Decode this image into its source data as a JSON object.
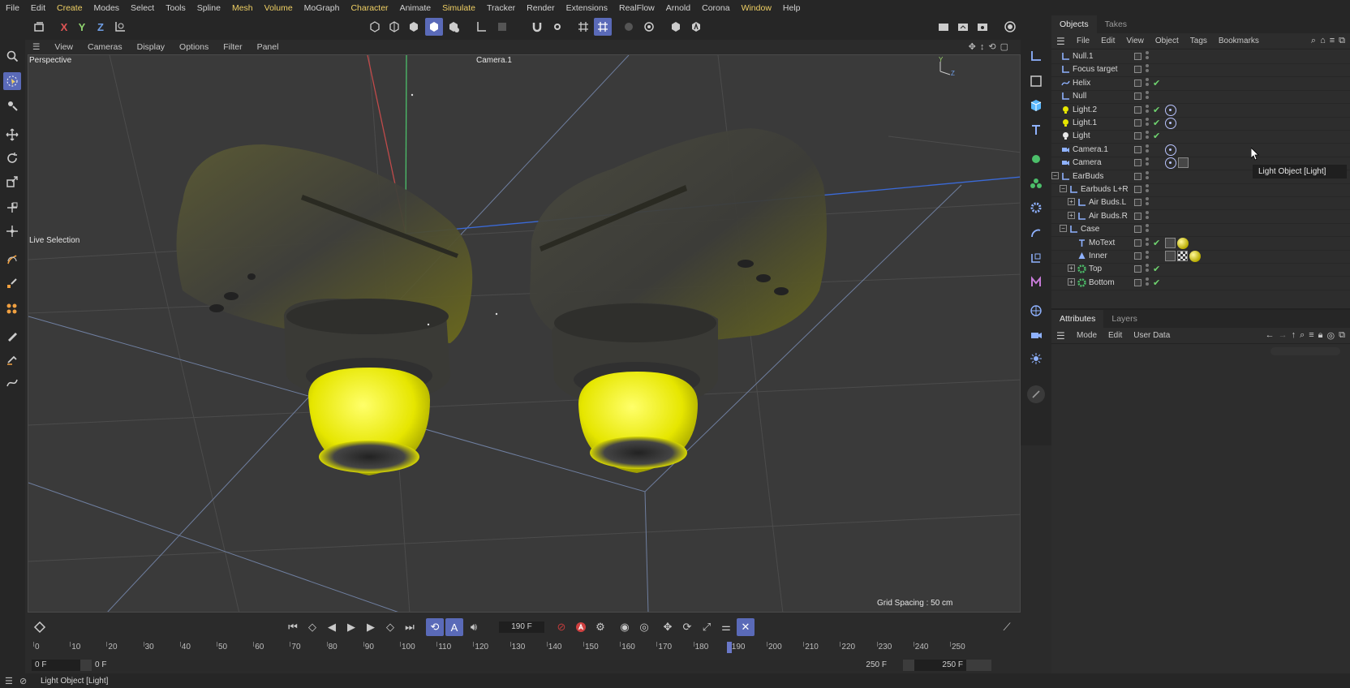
{
  "menubar": {
    "items": [
      {
        "label": "File",
        "hl": false
      },
      {
        "label": "Edit",
        "hl": false
      },
      {
        "label": "Create",
        "hl": true
      },
      {
        "label": "Modes",
        "hl": false
      },
      {
        "label": "Select",
        "hl": false
      },
      {
        "label": "Tools",
        "hl": false
      },
      {
        "label": "Spline",
        "hl": false
      },
      {
        "label": "Mesh",
        "hl": true
      },
      {
        "label": "Volume",
        "hl": true
      },
      {
        "label": "MoGraph",
        "hl": false
      },
      {
        "label": "Character",
        "hl": true
      },
      {
        "label": "Animate",
        "hl": false
      },
      {
        "label": "Simulate",
        "hl": true
      },
      {
        "label": "Tracker",
        "hl": false
      },
      {
        "label": "Render",
        "hl": false
      },
      {
        "label": "Extensions",
        "hl": false
      },
      {
        "label": "RealFlow",
        "hl": false
      },
      {
        "label": "Arnold",
        "hl": false
      },
      {
        "label": "Corona",
        "hl": false
      },
      {
        "label": "Window",
        "hl": true
      },
      {
        "label": "Help",
        "hl": false
      }
    ]
  },
  "axis_toggles": {
    "x": "X",
    "y": "Y",
    "z": "Z"
  },
  "viewport": {
    "menu": [
      "View",
      "Cameras",
      "Display",
      "Options",
      "Filter",
      "Panel"
    ],
    "label": "Perspective",
    "camera_label": "Camera.1",
    "tool_label": "Live Selection",
    "grid_spacing": "Grid Spacing : 50 cm"
  },
  "objects_panel": {
    "tabs": [
      "Objects",
      "Takes"
    ],
    "menu": [
      "File",
      "Edit",
      "View",
      "Object",
      "Tags",
      "Bookmarks"
    ],
    "tooltip": "Light Object [Light]",
    "rows": [
      {
        "name": "Null.1",
        "depth": 0,
        "icon": "null",
        "vis": "",
        "exp": "",
        "tags": []
      },
      {
        "name": "Focus target",
        "depth": 0,
        "icon": "null",
        "vis": "",
        "exp": "",
        "tags": []
      },
      {
        "name": "Helix",
        "depth": 0,
        "icon": "spline",
        "vis": "✔",
        "exp": "",
        "tags": []
      },
      {
        "name": "Null",
        "depth": 0,
        "icon": "null",
        "vis": "",
        "exp": "",
        "tags": []
      },
      {
        "name": "Light.2",
        "depth": 0,
        "icon": "light-yellow",
        "vis": "✔",
        "exp": "",
        "tags": [
          "target"
        ]
      },
      {
        "name": "Light.1",
        "depth": 0,
        "icon": "light-yellow",
        "vis": "✔",
        "exp": "",
        "tags": [
          "target"
        ]
      },
      {
        "name": "Light",
        "depth": 0,
        "icon": "light-white",
        "vis": "✔",
        "exp": "",
        "tags": []
      },
      {
        "name": "Camera.1",
        "depth": 0,
        "icon": "camera",
        "vis": "",
        "exp": "",
        "tags": [
          "target"
        ]
      },
      {
        "name": "Camera",
        "depth": 0,
        "icon": "camera",
        "vis": "",
        "exp": "",
        "tags": [
          "target",
          "protect"
        ]
      },
      {
        "name": "EarBuds",
        "depth": 0,
        "icon": "null",
        "vis": "",
        "exp": "−",
        "tags": []
      },
      {
        "name": "Earbuds L+R",
        "depth": 1,
        "icon": "null",
        "vis": "",
        "exp": "−",
        "tags": []
      },
      {
        "name": "Air Buds.L",
        "depth": 2,
        "icon": "null",
        "vis": "",
        "exp": "+",
        "tags": []
      },
      {
        "name": "Air Buds.R",
        "depth": 2,
        "icon": "null",
        "vis": "",
        "exp": "+",
        "tags": []
      },
      {
        "name": "Case",
        "depth": 1,
        "icon": "null",
        "vis": "",
        "exp": "−",
        "tags": []
      },
      {
        "name": "MoText",
        "depth": 2,
        "icon": "motext",
        "vis": "✔",
        "exp": "",
        "tags": [
          "phong",
          "material"
        ]
      },
      {
        "name": "Inner",
        "depth": 2,
        "icon": "poly",
        "vis": "",
        "exp": "",
        "tags": [
          "phong",
          "uvw",
          "material"
        ]
      },
      {
        "name": "Top",
        "depth": 2,
        "icon": "green",
        "vis": "✔",
        "exp": "+",
        "tags": []
      },
      {
        "name": "Bottom",
        "depth": 2,
        "icon": "green",
        "vis": "✔",
        "exp": "+",
        "tags": []
      }
    ]
  },
  "attributes_panel": {
    "tabs": [
      "Attributes",
      "Layers"
    ],
    "menu": [
      "Mode",
      "Edit",
      "User Data"
    ]
  },
  "timeline": {
    "current_frame": "190 F",
    "ticks": [
      "0",
      "10",
      "20",
      "30",
      "40",
      "50",
      "60",
      "70",
      "80",
      "90",
      "100",
      "110",
      "120",
      "130",
      "140",
      "150",
      "160",
      "170",
      "180",
      "190",
      "200",
      "210",
      "220",
      "230",
      "240",
      "250"
    ],
    "playhead_frame": 190,
    "max_frame": 250,
    "range_start": "0 F",
    "range_start_inner": "0 F",
    "range_end_inner": "250 F",
    "range_end": "250 F"
  },
  "statusbar": {
    "text": "Light Object [Light]"
  },
  "colors": {
    "accent": "#5a6ab8",
    "yellow": "#e6e600",
    "check": "#6fd36f"
  }
}
